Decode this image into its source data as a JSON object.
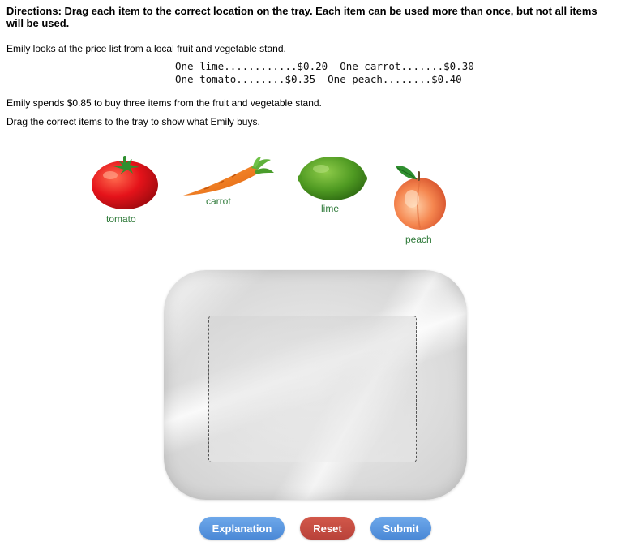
{
  "directions": "Directions: Drag each item to the correct location on the tray. Each item can be used more than once, but not all items will be used.",
  "intro": "Emily looks at the price list from a local fruit and vegetable stand.",
  "price_list": {
    "row1": "One lime............$0.20  One carrot.......$0.30",
    "row2": "One tomato........$0.35  One peach........$0.40"
  },
  "question": "Emily spends $0.85 to buy three items from the fruit and vegetable stand.",
  "instruction": "Drag the correct items to the tray to show what Emily buys.",
  "items": [
    {
      "label": "tomato",
      "icon": "tomato-icon"
    },
    {
      "label": "carrot",
      "icon": "carrot-icon"
    },
    {
      "label": "lime",
      "icon": "lime-icon"
    },
    {
      "label": "peach",
      "icon": "peach-icon"
    }
  ],
  "buttons": {
    "explanation": "Explanation",
    "reset": "Reset",
    "submit": "Submit"
  },
  "colors": {
    "label_green": "#2f7a3a",
    "button_blue": "#4a88d6",
    "button_red": "#b9423a"
  }
}
